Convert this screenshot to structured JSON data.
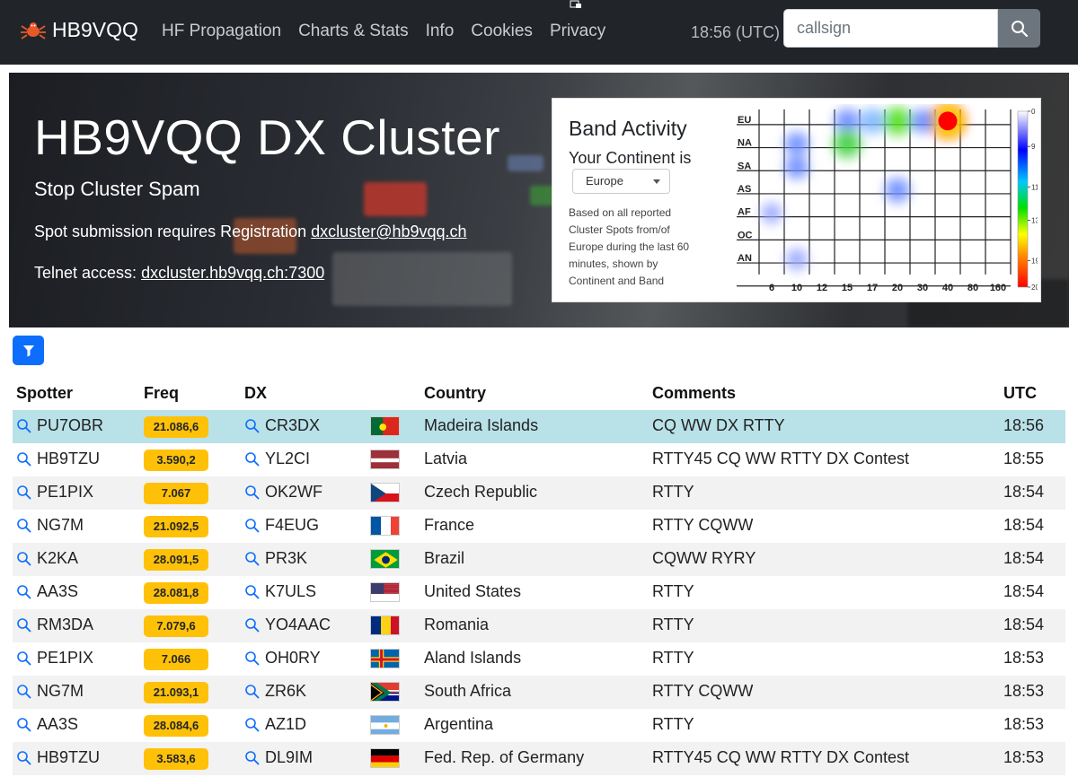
{
  "app": {
    "brand": "HB9VQQ",
    "nav": [
      "HF Propagation",
      "Charts & Stats",
      "Info",
      "Cookies",
      "Privacy"
    ],
    "clock": "18:56 (UTC)",
    "search": {
      "placeholder": "callsign"
    }
  },
  "hero": {
    "title": "HB9VQQ DX Cluster",
    "subtitle": "Stop Cluster Spam",
    "registration_text": "Spot submission requires Registration",
    "registration_email": "dxcluster@hb9vqq.ch",
    "telnet_text": "Telnet access:",
    "telnet_host": "dxcluster.hb9vqq.ch:7300"
  },
  "band_activity": {
    "title": "Band Activity",
    "continent_label": "Your Continent is",
    "continent_selected": "Europe",
    "description": "Based on all reported Cluster Spots from/of Europe during the last 60 minutes, shown by Continent and Band",
    "continents": [
      "EU",
      "NA",
      "SA",
      "AS",
      "AF",
      "OC",
      "AN"
    ],
    "bands": [
      "6",
      "10",
      "12",
      "15",
      "17",
      "20",
      "30",
      "40",
      "80",
      "160"
    ],
    "scale_ticks": [
      "0",
      "9",
      "11",
      "13",
      "19",
      "20"
    ],
    "hotspots": [
      {
        "continent": "EU",
        "band": "40",
        "level": 20
      },
      {
        "continent": "EU",
        "band": "20",
        "level": 14
      },
      {
        "continent": "EU",
        "band": "17",
        "level": 11
      },
      {
        "continent": "EU",
        "band": "15",
        "level": 10
      },
      {
        "continent": "EU",
        "band": "30",
        "level": 9
      },
      {
        "continent": "NA",
        "band": "15",
        "level": 13
      },
      {
        "continent": "NA",
        "band": "10",
        "level": 9
      },
      {
        "continent": "SA",
        "band": "10",
        "level": 9
      },
      {
        "continent": "AS",
        "band": "20",
        "level": 10
      },
      {
        "continent": "AN",
        "band": "10",
        "level": 7
      },
      {
        "continent": "AF",
        "band": "6",
        "level": 6
      }
    ]
  },
  "table": {
    "headers": {
      "spotter": "Spotter",
      "freq": "Freq",
      "dx": "DX",
      "country": "Country",
      "comments": "Comments",
      "utc": "UTC"
    },
    "rows": [
      {
        "spotter": "PU7OBR",
        "freq": "21.086,6",
        "dx": "CR3DX",
        "flag": "pt",
        "country": "Madeira Islands",
        "comment": "CQ WW DX RTTY",
        "utc": "18:56"
      },
      {
        "spotter": "HB9TZU",
        "freq": "3.590,2",
        "dx": "YL2CI",
        "flag": "lv",
        "country": "Latvia",
        "comment": "RTTY45 CQ WW RTTY DX Contest",
        "utc": "18:55"
      },
      {
        "spotter": "PE1PIX",
        "freq": "7.067",
        "dx": "OK2WF",
        "flag": "cz",
        "country": "Czech Republic",
        "comment": "RTTY",
        "utc": "18:54"
      },
      {
        "spotter": "NG7M",
        "freq": "21.092,5",
        "dx": "F4EUG",
        "flag": "fr",
        "country": "France",
        "comment": "RTTY CQWW",
        "utc": "18:54"
      },
      {
        "spotter": "K2KA",
        "freq": "28.091,5",
        "dx": "PR3K",
        "flag": "br",
        "country": "Brazil",
        "comment": "CQWW RYRY",
        "utc": "18:54"
      },
      {
        "spotter": "AA3S",
        "freq": "28.081,8",
        "dx": "K7ULS",
        "flag": "us",
        "country": "United States",
        "comment": "RTTY",
        "utc": "18:54"
      },
      {
        "spotter": "RM3DA",
        "freq": "7.079,6",
        "dx": "YO4AAC",
        "flag": "ro",
        "country": "Romania",
        "comment": "RTTY",
        "utc": "18:54"
      },
      {
        "spotter": "PE1PIX",
        "freq": "7.066",
        "dx": "OH0RY",
        "flag": "ax",
        "country": "Aland Islands",
        "comment": "RTTY",
        "utc": "18:53"
      },
      {
        "spotter": "NG7M",
        "freq": "21.093,1",
        "dx": "ZR6K",
        "flag": "za",
        "country": "South Africa",
        "comment": "RTTY CQWW",
        "utc": "18:53"
      },
      {
        "spotter": "AA3S",
        "freq": "28.084,6",
        "dx": "AZ1D",
        "flag": "ar",
        "country": "Argentina",
        "comment": "RTTY",
        "utc": "18:53"
      },
      {
        "spotter": "HB9TZU",
        "freq": "3.583,6",
        "dx": "DL9IM",
        "flag": "de",
        "country": "Fed. Rep. of Germany",
        "comment": "RTTY45 CQ WW RTTY DX Contest",
        "utc": "18:53"
      }
    ]
  },
  "colors": {
    "navbar": "#212529",
    "freq_badge": "#ffc107",
    "filter_button": "#0d6efd",
    "highlight_row": "#b9e1e8"
  }
}
